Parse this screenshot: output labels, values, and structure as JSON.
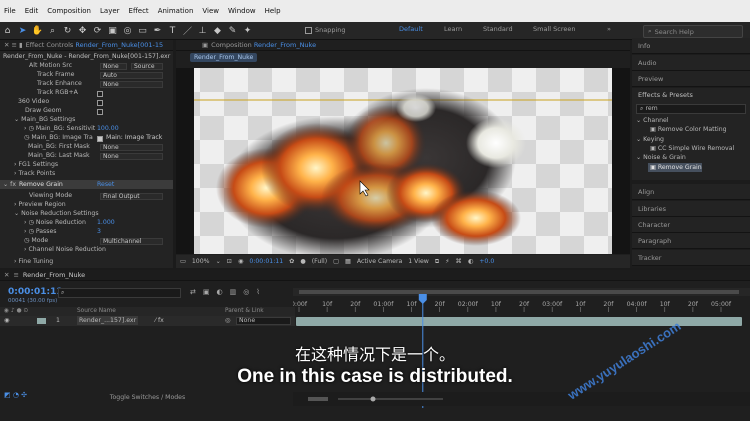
{
  "menu": [
    "File",
    "Edit",
    "Composition",
    "Layer",
    "Effect",
    "Animation",
    "View",
    "Window",
    "Help"
  ],
  "toolbar": {
    "snapping_label": "Snapping",
    "workspaces": [
      "Default",
      "Learn",
      "Standard",
      "Small Screen"
    ],
    "more_icon": "»",
    "search_placeholder": "Search Help"
  },
  "effect_controls": {
    "tab_label": "Effect Controls",
    "tab_target": "Render_From_Nuke[001-15",
    "header": "Render_From_Nuke - Render_From_Nuke[001-157].exr",
    "rows": [
      {
        "label": "Alt Motion Src",
        "value": "None",
        "value2": "Source"
      },
      {
        "label": "Track Frame",
        "value": "Auto"
      },
      {
        "label": "Track Enhance",
        "value": "None"
      },
      {
        "label": "Track RGB+A"
      },
      {
        "label": "360 Video"
      },
      {
        "label": "Draw Geom"
      },
      {
        "label": "Main_BG Settings"
      },
      {
        "label": "Main_BG: Sensitivit",
        "value": "100.00"
      },
      {
        "label": "Main_BG: Image Tra",
        "value": "Main: Image Track"
      },
      {
        "label": "Main_BG: First Mask",
        "value": "None"
      },
      {
        "label": "Main_BG: Last Mask",
        "value": "None"
      },
      {
        "label": "FG1 Settings"
      },
      {
        "label": "Track Points"
      },
      {
        "label": "Remove Grain",
        "value": "Reset"
      },
      {
        "label": "Viewing Mode",
        "value": "Final Output"
      },
      {
        "label": "Preview Region"
      },
      {
        "label": "Noise Reduction Settings"
      },
      {
        "label": "Noise Reduction",
        "value": "1.000"
      },
      {
        "label": "Passes",
        "value": "3"
      },
      {
        "label": "Mode",
        "value": "Multichannel"
      },
      {
        "label": "Channel Noise Reduction"
      },
      {
        "label": "Fine Tuning"
      }
    ]
  },
  "composition": {
    "tab_label": "Composition",
    "tab_target": "Render_From_Nuke",
    "breadcrumb": "Render_From_Nuke",
    "zoom": "100%",
    "timecode": "0:00:01:11",
    "resolution": "(Full)",
    "camera": "Active Camera",
    "views": "1 View",
    "exposure": "+0.0"
  },
  "right_panel": {
    "top_items": [
      "Info",
      "Audio",
      "Preview"
    ],
    "effects_title": "Effects & Presets",
    "search_value": "rem",
    "tree": [
      {
        "label": "Channel",
        "type": "group"
      },
      {
        "label": "Remove Color Matting",
        "type": "item"
      },
      {
        "label": "Keying",
        "type": "group"
      },
      {
        "label": "CC Simple Wire Removal",
        "type": "item"
      },
      {
        "label": "Noise & Grain",
        "type": "group"
      },
      {
        "label": "Remove Grain",
        "type": "item",
        "selected": true
      }
    ],
    "bottom_items": [
      "Align",
      "Libraries",
      "Character",
      "Paragraph",
      "Tracker"
    ]
  },
  "timeline": {
    "tab_label": "Render_From_Nuke",
    "timecode": "0:00:01:11",
    "frame_info": "00041 (30.00 fps)",
    "search_placeholder": "",
    "columns": {
      "source": "Source Name",
      "parent": "Parent & Link"
    },
    "layer": {
      "num": "1",
      "name": "Render_...157].exr",
      "parent": "None"
    },
    "ruler": [
      "0:00f",
      "10f",
      "20f",
      "01:00f",
      "10f",
      "20f",
      "02:00f",
      "10f",
      "20f",
      "03:00f",
      "10f",
      "20f",
      "04:00f",
      "10f",
      "20f",
      "05:00f"
    ],
    "footer": "Toggle Switches / Modes"
  },
  "subtitles": {
    "cn": "在这种情况下是一个。",
    "en": "One in this case is distributed."
  },
  "watermark": "www.yuyulaoshi.com",
  "colors": {
    "accent": "#4a8fe6",
    "track_bar": "#8fa9a7",
    "selected": "#46505e"
  }
}
